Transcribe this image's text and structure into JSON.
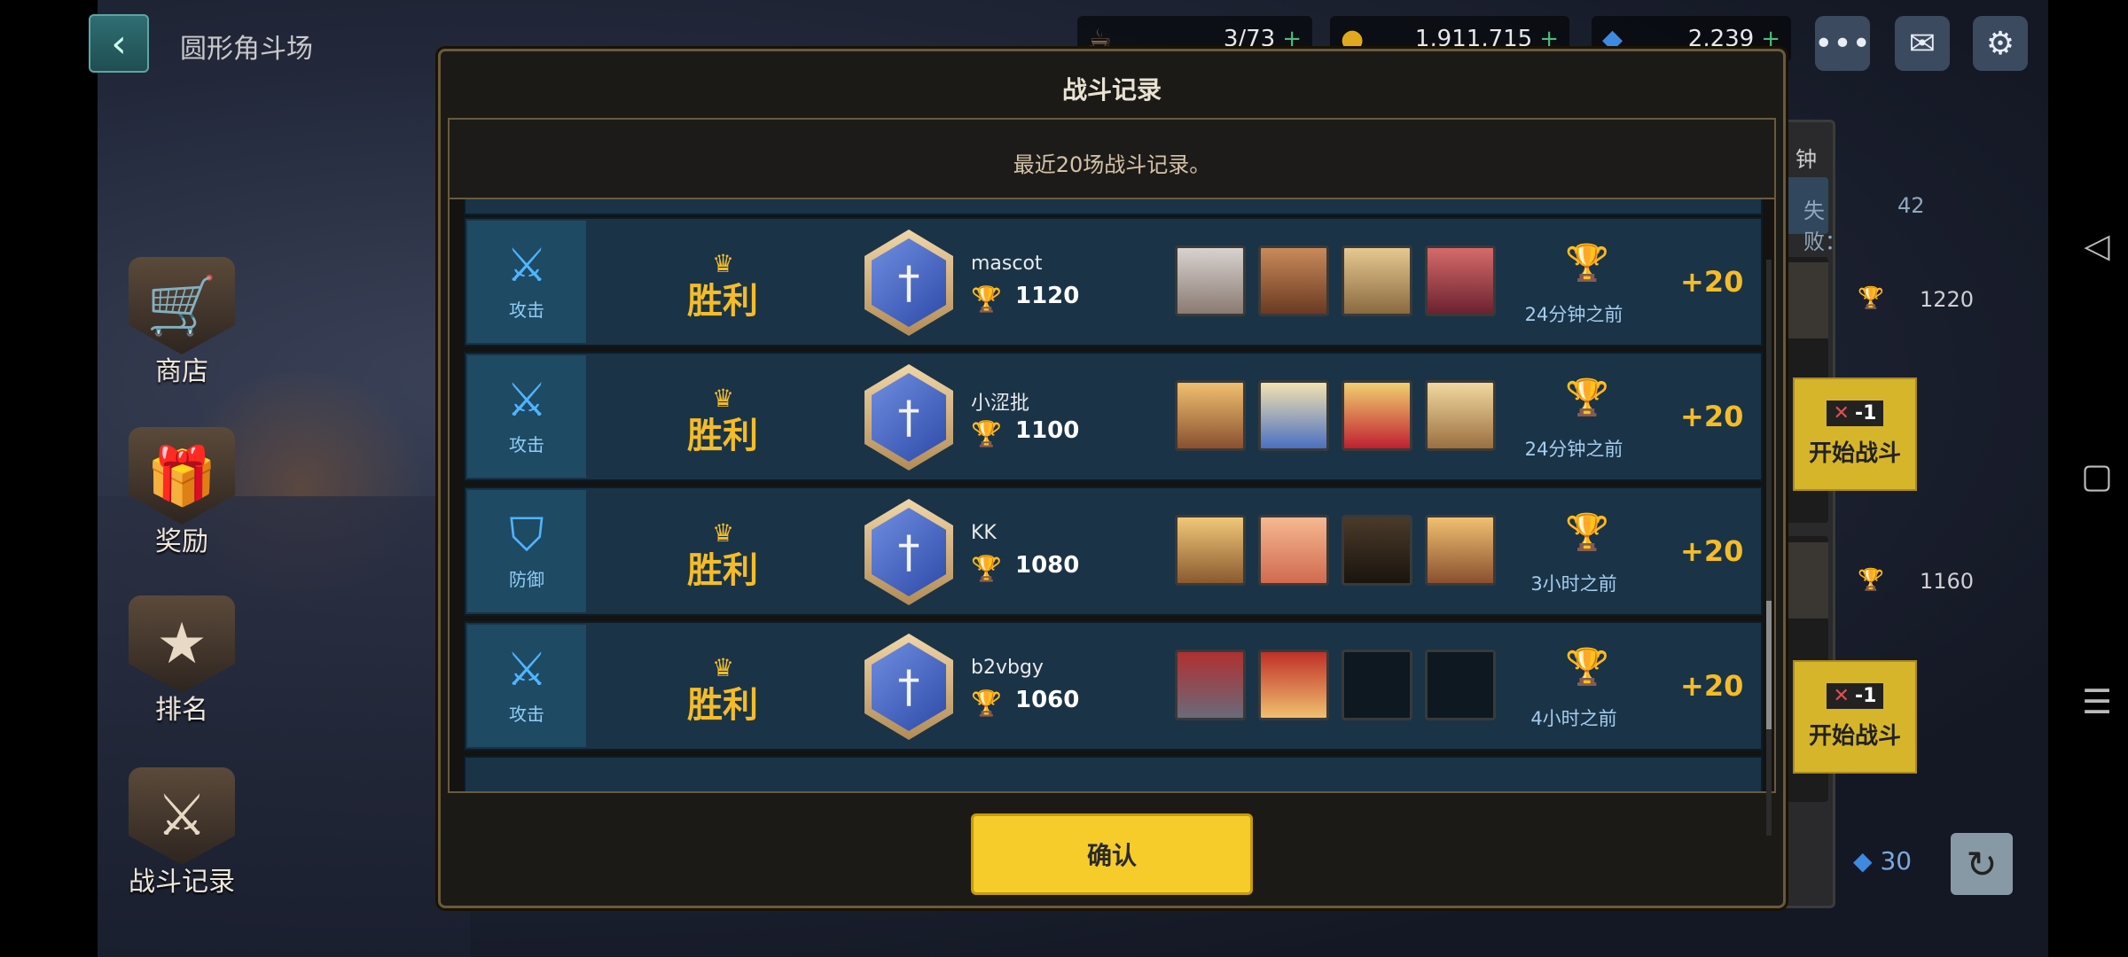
{
  "header": {
    "title": "圆形角斗场",
    "resources": [
      {
        "icon": "stamina-icon",
        "value": "3/73"
      },
      {
        "icon": "gold-coin-icon",
        "value": "1,911,715"
      },
      {
        "icon": "gem-icon",
        "value": "2,239"
      }
    ]
  },
  "side_menu": [
    {
      "label": "商店",
      "icon": "shop-cart-icon"
    },
    {
      "label": "奖励",
      "icon": "gift-icon"
    },
    {
      "label": "排名",
      "icon": "ranking-icon"
    },
    {
      "label": "战斗记录",
      "icon": "battle-record-icon"
    }
  ],
  "right_panel": {
    "time_suffix": "钟",
    "loss_label": "失败：",
    "loss_count": "42",
    "opponents": [
      {
        "score": "1220",
        "cost": "-1",
        "button": "开始战斗"
      },
      {
        "score": "1160",
        "cost": "-1",
        "button": "开始战斗"
      }
    ],
    "refresh_cost": "30"
  },
  "modal": {
    "title": "战斗记录",
    "subtitle": "最近20场战斗记录。",
    "confirm_label": "确认",
    "records": [
      {
        "type": "攻击",
        "result": "胜利",
        "name": "mascot",
        "score": "1120",
        "time": "24分钟之前",
        "points": "+20",
        "heroes": 4
      },
      {
        "type": "攻击",
        "result": "胜利",
        "name": "小涩批",
        "score": "1100",
        "time": "24分钟之前",
        "points": "+20",
        "heroes": 4
      },
      {
        "type": "防御",
        "result": "胜利",
        "name": "KK",
        "score": "1080",
        "time": "3小时之前",
        "points": "+20",
        "heroes": 4
      },
      {
        "type": "攻击",
        "result": "胜利",
        "name": "b2vbgy",
        "score": "1060",
        "time": "4小时之前",
        "points": "+20",
        "heroes": 2
      }
    ]
  }
}
